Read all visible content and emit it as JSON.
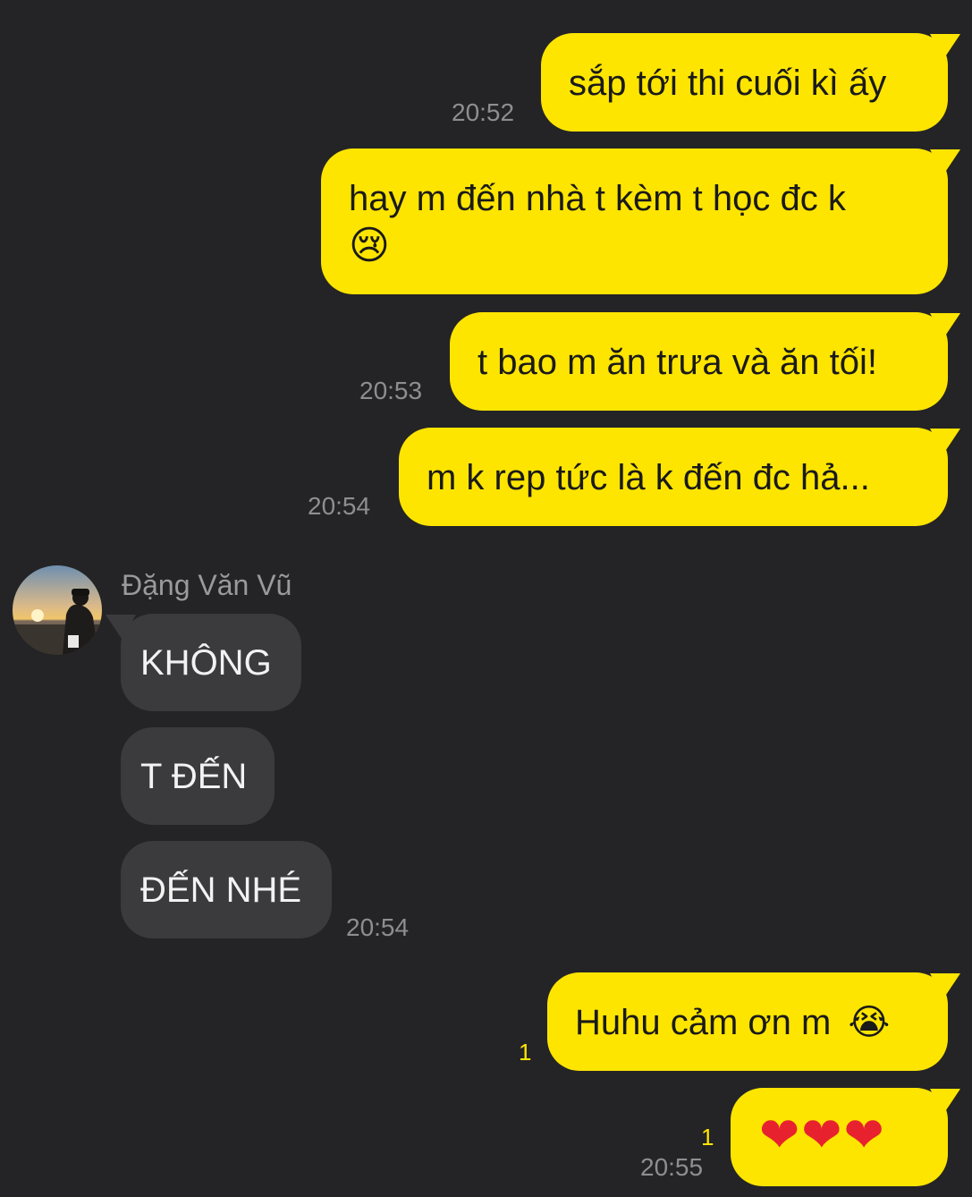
{
  "messages_out": {
    "m1": {
      "text": "sắp tới thi cuối kì ấy",
      "time": "20:52"
    },
    "m2": {
      "text_line1": "hay m đến nhà t kèm t học đc k",
      "emoji": "😢"
    },
    "m3": {
      "text": "t bao m ăn trưa và ăn tối!",
      "time": "20:53"
    },
    "m4": {
      "text": "m k rep tức là k đến đc hả...",
      "time": "20:54"
    }
  },
  "incoming": {
    "sender_name": "Đặng Văn Vũ",
    "m5": {
      "text": "KHÔNG"
    },
    "m6": {
      "text": "T ĐẾN"
    },
    "m7": {
      "text": "ĐẾN NHÉ",
      "time": "20:54"
    }
  },
  "messages_out_2": {
    "m8": {
      "text": "Huhu cảm ơn m",
      "emoji": "😭",
      "unread": "1"
    },
    "m9": {
      "hearts": [
        "❤",
        "❤",
        "❤"
      ],
      "unread": "1",
      "time": "20:55"
    }
  },
  "colors": {
    "background": "#242426",
    "outgoing_bubble": "#FEE500",
    "incoming_bubble": "#3b3b3d",
    "timestamp": "#8e8e92",
    "unread_count": "#FEE500",
    "heart": "#e8212f"
  },
  "icons": {
    "avatar": "profile-photo-sunset"
  }
}
